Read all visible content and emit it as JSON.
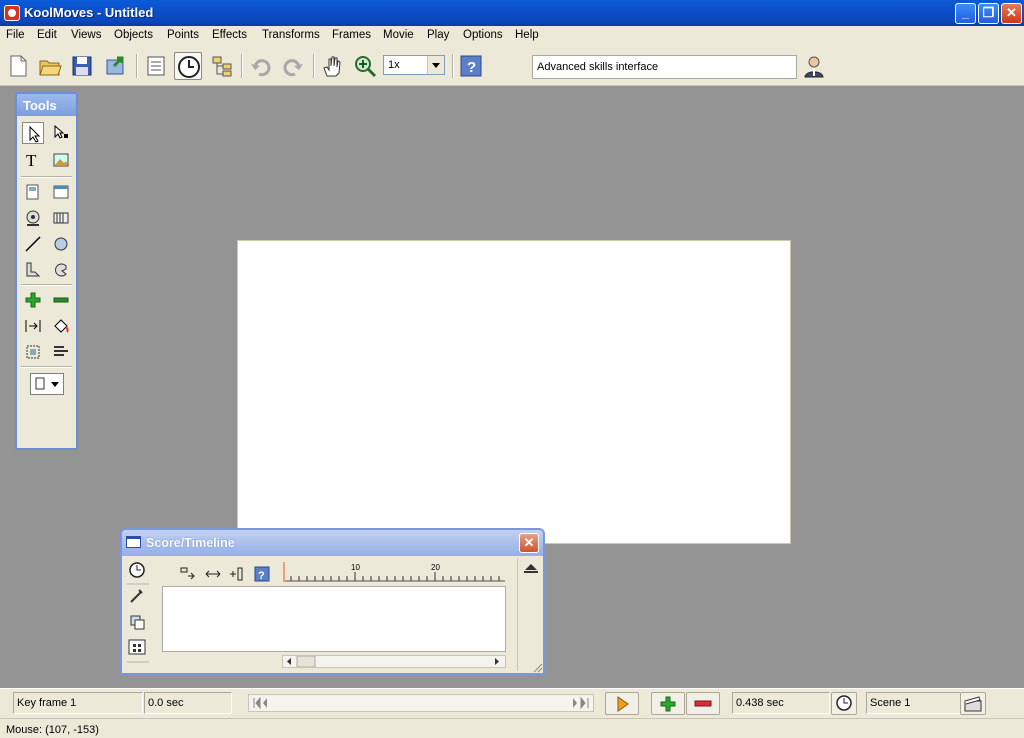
{
  "window": {
    "title": "KoolMoves - Untitled"
  },
  "menu": [
    "File",
    "Edit",
    "Views",
    "Objects",
    "Points",
    "Effects",
    "Transforms",
    "Frames",
    "Movie",
    "Play",
    "Options",
    "Help"
  ],
  "toolbar": {
    "zoom_value": "1x",
    "interface_label": "Advanced skills interface"
  },
  "tools_palette": {
    "title": "Tools"
  },
  "timeline": {
    "title": "Score/Timeline",
    "ruler_labels": [
      "10",
      "20"
    ]
  },
  "bottom": {
    "keyframe": "Key frame 1",
    "time": "0.0 sec",
    "duration": "0.438 sec",
    "scene": "Scene 1"
  },
  "status": {
    "mouse": "Mouse: (107, -153)"
  },
  "colors": {
    "titlebar": "#0a5bd8",
    "workspace": "#949494",
    "stage": "#ffffff",
    "chrome": "#ece9d8"
  }
}
